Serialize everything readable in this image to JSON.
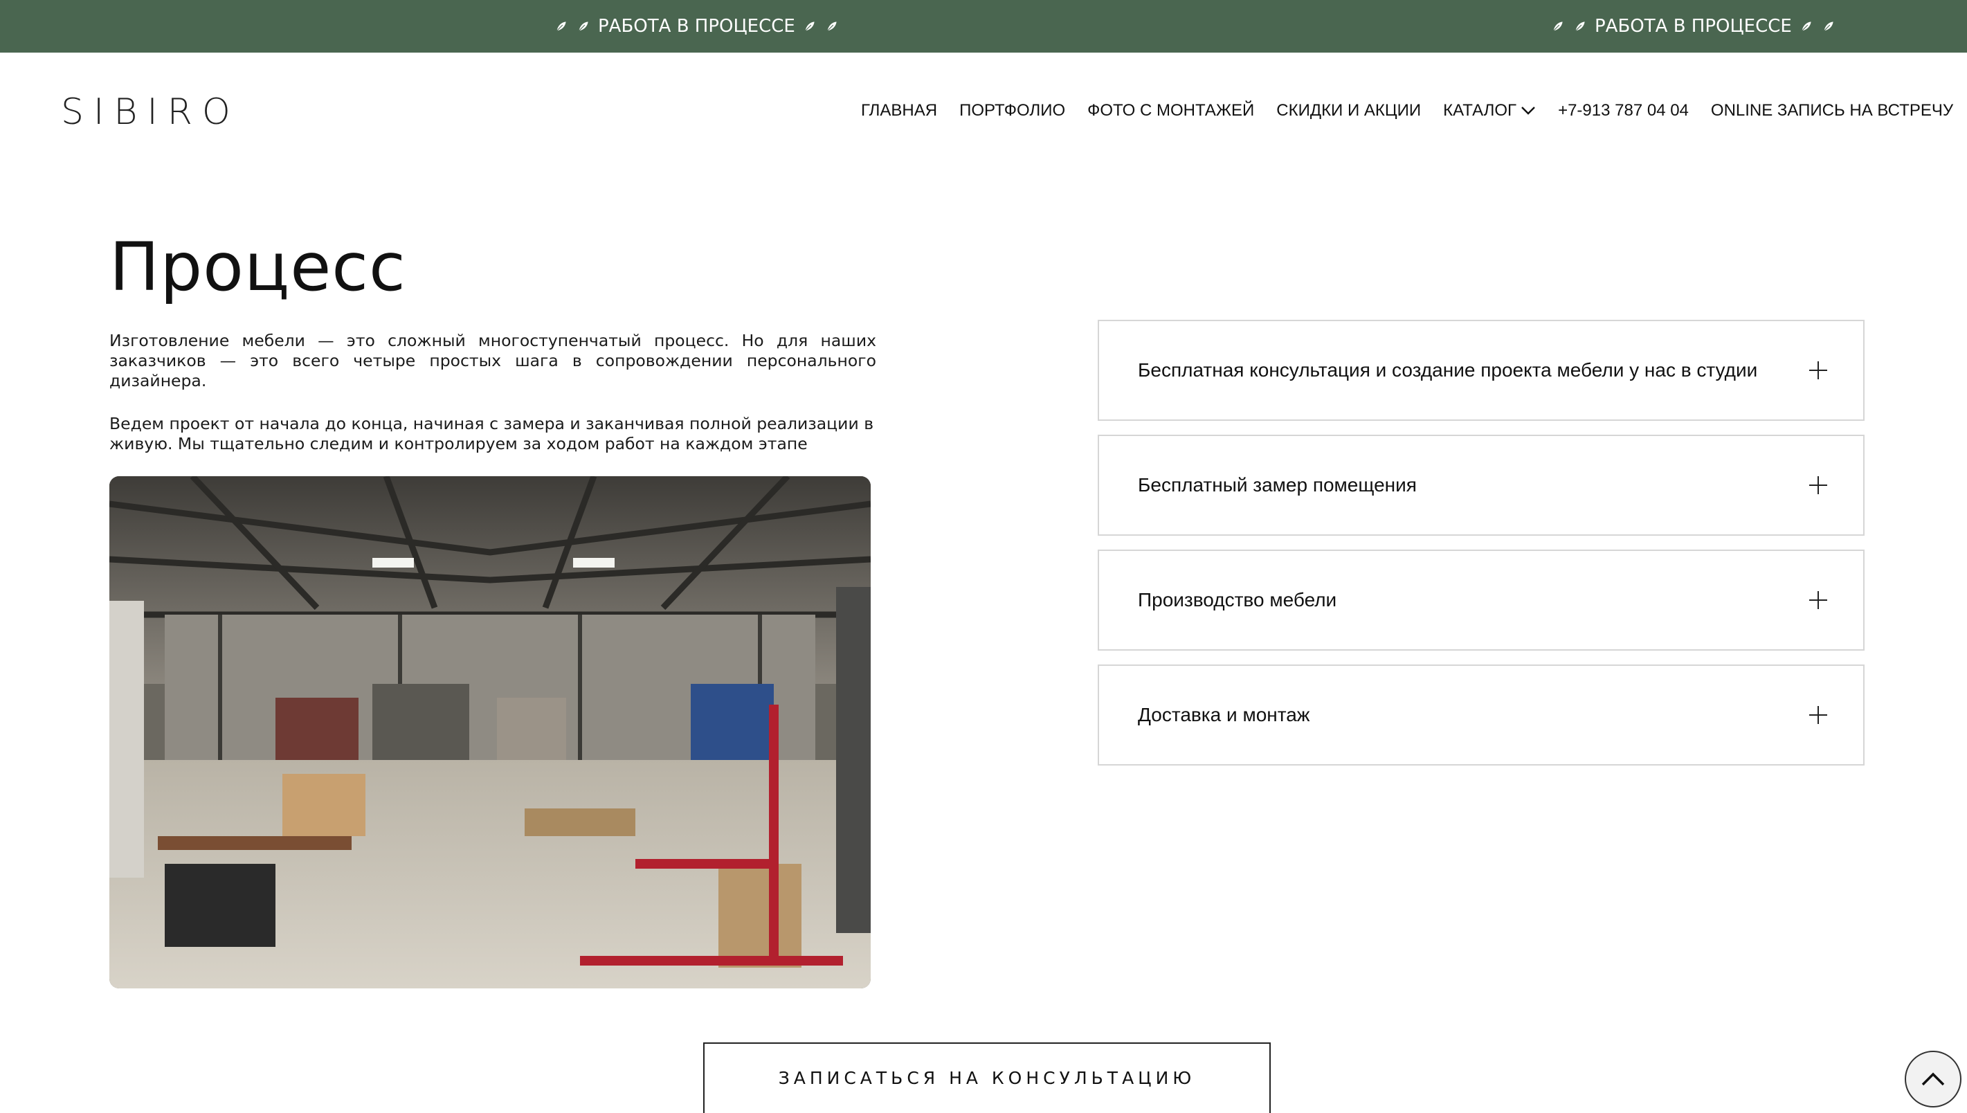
{
  "banner": {
    "items": [
      {
        "text": "РАБОТА В ПРОЦЕССЕ"
      },
      {
        "text": "РАБОТА В ПРОЦЕССЕ"
      }
    ],
    "leaf_icon": "leaf-icon",
    "bg_color": "#4a6650"
  },
  "header": {
    "logo": "SIBIRO",
    "nav": [
      {
        "label": "ГЛАВНАЯ"
      },
      {
        "label": "ПОРТФОЛИО"
      },
      {
        "label": "ФОТО С МОНТАЖЕЙ"
      },
      {
        "label": "СКИДКИ И АКЦИИ"
      },
      {
        "label": "КАТАЛОГ"
      },
      {
        "label": "+7-913 787 04 04"
      },
      {
        "label": "ONLINE ЗАПИСЬ НА ВСТРЕЧУ"
      }
    ]
  },
  "main": {
    "title": "Процесс",
    "paragraph1": "Изготовление мебели — это сложный многоступенчатый процесс. Но для наших заказчиков — это всего четыре простых шага в сопровождении персонального дизайнера.",
    "paragraph2": "Ведем проект от начала до конца, начиная с замера и заканчивая полной реализации в живую. Мы тщательно следим и контролируем за ходом работ на каждом этапе",
    "photo_icon": "workshop-photo"
  },
  "accordion": {
    "items": [
      {
        "label": "Бесплатная консультация и создание проекта мебели у нас в студии"
      },
      {
        "label": "Бесплатный замер помещения"
      },
      {
        "label": "Производство мебели"
      },
      {
        "label": "Доставка и монтаж"
      }
    ]
  },
  "cta": {
    "label": "ЗАПИСАТЬСЯ НА КОНСУЛЬТАЦИЮ"
  },
  "scroll_top": {
    "icon": "chevron-up-icon"
  }
}
